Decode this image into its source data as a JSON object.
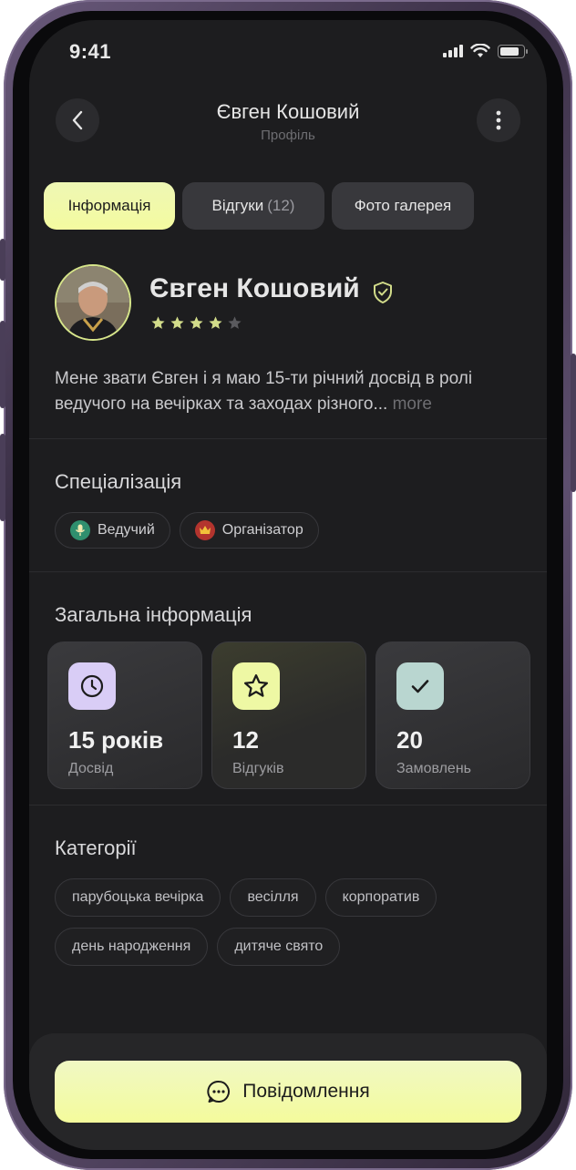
{
  "status_bar": {
    "time": "9:41"
  },
  "header": {
    "title": "Євген Кошовий",
    "subtitle": "Профіль"
  },
  "tabs": [
    {
      "label": "Інформація",
      "active": true
    },
    {
      "label": "Відгуки",
      "count": "(12)",
      "active": false
    },
    {
      "label": "Фото галерея",
      "active": false
    }
  ],
  "profile": {
    "name": "Євген Кошовий",
    "rating": 4,
    "rating_max": 5,
    "bio": "Мене звати Євген і я маю 15-ти річний досвід в ролі ведучого на вечірках та заходах різного...",
    "more_label": "more"
  },
  "specialization": {
    "title": "Спеціалізація",
    "items": [
      {
        "label": "Ведучий",
        "icon": "microphone-icon",
        "color": "#2f8f6e"
      },
      {
        "label": "Організатор",
        "icon": "crown-icon",
        "color": "#b3342e"
      }
    ]
  },
  "general_info": {
    "title": "Загальна інформація",
    "cards": [
      {
        "value": "15 років",
        "label": "Досвід",
        "icon": "clock-icon",
        "color": "#d9cdf6"
      },
      {
        "value": "12",
        "label": "Відгуків",
        "icon": "star-icon",
        "color": "#eef8a4"
      },
      {
        "value": "20",
        "label": "Замовлень",
        "icon": "check-icon",
        "color": "#b9d6d0"
      }
    ]
  },
  "categories": {
    "title": "Категорії",
    "items": [
      "парубоцька вечірка",
      "весілля",
      "корпоратив",
      "день народження",
      "дитяче свято"
    ]
  },
  "message_button": {
    "label": "Повідомлення",
    "icon": "chat-bubble-icon"
  },
  "colors": {
    "accent": "#f2fab0",
    "star": "#d2dc8a",
    "background": "#1d1d1f"
  }
}
